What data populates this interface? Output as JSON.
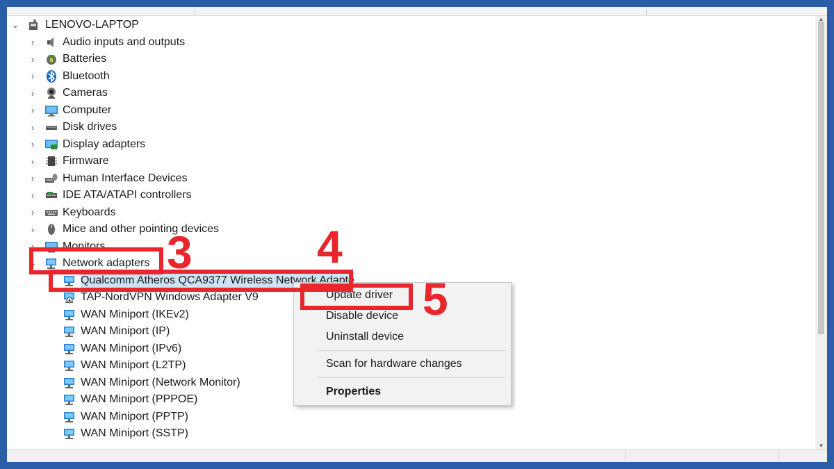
{
  "tree": {
    "root": {
      "label": "LENOVO-LAPTOP",
      "icon": "computer-root-icon"
    },
    "categories": [
      {
        "label": "Audio inputs and outputs",
        "icon": "speaker-icon"
      },
      {
        "label": "Batteries",
        "icon": "battery-icon"
      },
      {
        "label": "Bluetooth",
        "icon": "bluetooth-icon"
      },
      {
        "label": "Cameras",
        "icon": "camera-icon"
      },
      {
        "label": "Computer",
        "icon": "monitor-icon"
      },
      {
        "label": "Disk drives",
        "icon": "disk-drive-icon"
      },
      {
        "label": "Display adapters",
        "icon": "display-adapter-icon"
      },
      {
        "label": "Firmware",
        "icon": "firmware-chip-icon"
      },
      {
        "label": "Human Interface Devices",
        "icon": "hid-icon"
      },
      {
        "label": "IDE ATA/ATAPI controllers",
        "icon": "ide-controller-icon"
      },
      {
        "label": "Keyboards",
        "icon": "keyboard-icon"
      },
      {
        "label": "Mice and other pointing devices",
        "icon": "mouse-icon"
      },
      {
        "label": "Monitors",
        "icon": "monitor-icon"
      },
      {
        "label": "Network adapters",
        "icon": "network-adapter-icon"
      }
    ],
    "network_adapters": [
      {
        "label": "Qualcomm Atheros QCA9377 Wireless Network Adapte",
        "icon": "network-adapter-icon"
      },
      {
        "label": "TAP-NordVPN Windows Adapter V9",
        "icon": "network-adapter-warning-icon"
      },
      {
        "label": "WAN Miniport (IKEv2)",
        "icon": "network-adapter-icon"
      },
      {
        "label": "WAN Miniport (IP)",
        "icon": "network-adapter-icon"
      },
      {
        "label": "WAN Miniport (IPv6)",
        "icon": "network-adapter-icon"
      },
      {
        "label": "WAN Miniport (L2TP)",
        "icon": "network-adapter-icon"
      },
      {
        "label": "WAN Miniport (Network Monitor)",
        "icon": "network-adapter-icon"
      },
      {
        "label": "WAN Miniport (PPPOE)",
        "icon": "network-adapter-icon"
      },
      {
        "label": "WAN Miniport (PPTP)",
        "icon": "network-adapter-icon"
      },
      {
        "label": "WAN Miniport (SSTP)",
        "icon": "network-adapter-icon"
      }
    ]
  },
  "context_menu": {
    "update_driver": "Update driver",
    "disable_device": "Disable device",
    "uninstall_device": "Uninstall device",
    "scan_hardware": "Scan for hardware changes",
    "properties": "Properties"
  },
  "annotations": {
    "step3": "3",
    "step4": "4",
    "step5": "5",
    "color": "#e8262b"
  },
  "colors": {
    "frame": "#2a5ea8",
    "adapter_icon": "#3a8fd6"
  }
}
